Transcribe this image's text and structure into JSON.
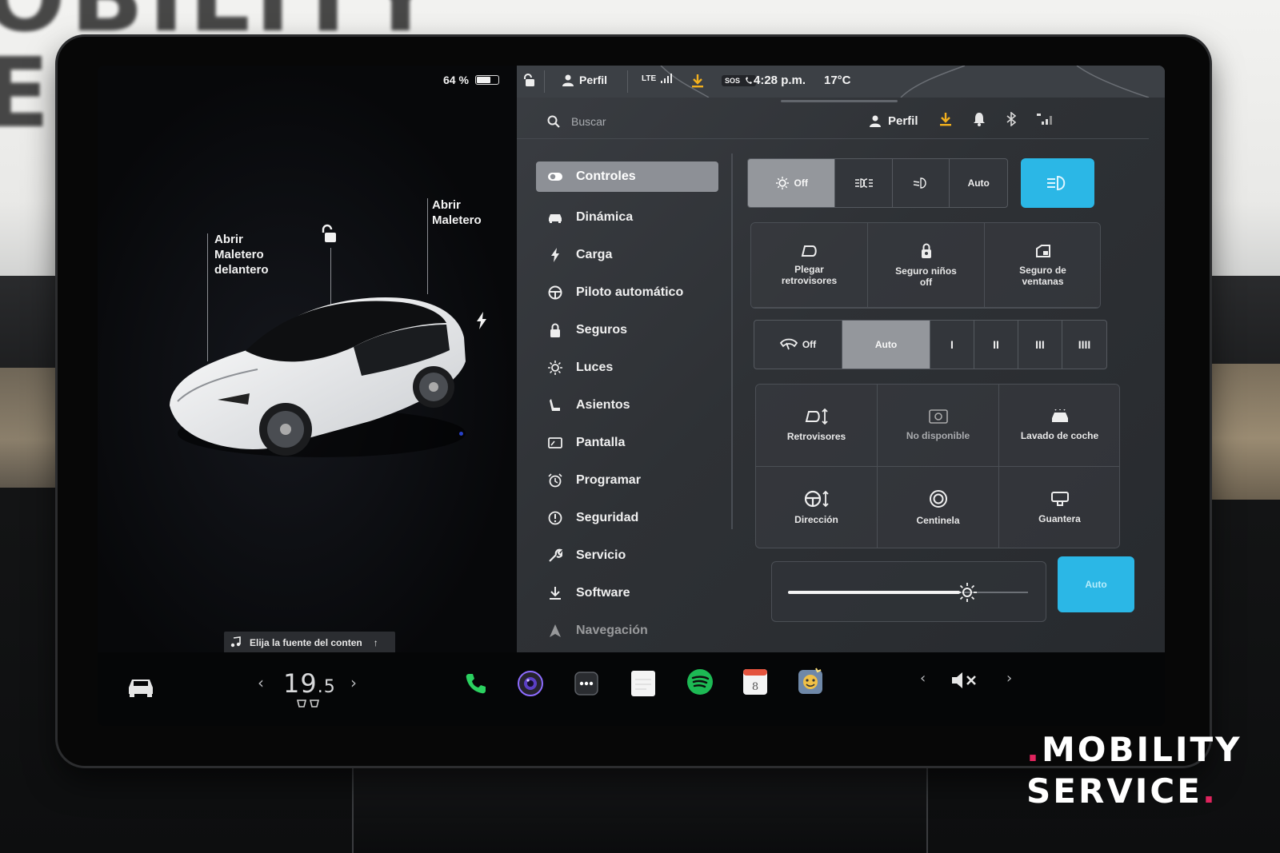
{
  "photo": {
    "wall_text": "OBILITY\nER",
    "watermark_line1": "MOBILITY",
    "watermark_line2": "SERVICE",
    "watermark_dot": ".",
    "watermark_dot_color": "#e0245e"
  },
  "car": {
    "battery_percent": "64 %",
    "battery_level": 0.64,
    "frunk_label": "Abrir\nMaletero\ndelantero",
    "trunk_label": "Abrir\nMaletero",
    "charge_icon": "bolt-icon",
    "lock_icon": "unlock-icon",
    "media_source": "Elija la fuente del conten"
  },
  "status_bar": {
    "profile": "Perfil",
    "network": "LTE",
    "sos": "SOS",
    "time": "4:28 p.m.",
    "outside_temp": "17°C"
  },
  "search": {
    "placeholder": "Buscar",
    "profile": "Perfil"
  },
  "menu": {
    "items": [
      {
        "label": "Controles",
        "icon": "toggle-icon",
        "active": true
      },
      {
        "label": "Dinámica",
        "icon": "car-icon"
      },
      {
        "label": "Carga",
        "icon": "bolt-icon"
      },
      {
        "label": "Piloto automático",
        "icon": "steering-wheel-icon"
      },
      {
        "label": "Seguros",
        "icon": "lock-icon"
      },
      {
        "label": "Luces",
        "icon": "sun-icon"
      },
      {
        "label": "Asientos",
        "icon": "seat-icon"
      },
      {
        "label": "Pantalla",
        "icon": "display-icon"
      },
      {
        "label": "Programar",
        "icon": "alarm-clock-icon"
      },
      {
        "label": "Seguridad",
        "icon": "warning-circle-icon"
      },
      {
        "label": "Servicio",
        "icon": "wrench-icon"
      },
      {
        "label": "Software",
        "icon": "download-icon"
      },
      {
        "label": "Navegación",
        "icon": "navigation-arrow-icon"
      }
    ]
  },
  "controls": {
    "lights": {
      "options": [
        "Off",
        "Parking",
        "Low beam",
        "Auto"
      ],
      "off_label": "Off",
      "auto_label": "Auto",
      "selected": "Off",
      "high_beam_accent": "#2bb7e6"
    },
    "tiles_top": {
      "fold_mirrors": "Plegar\nretrovisores",
      "child_lock": "Seguro niños\noff",
      "window_lock": "Seguro de\nventanas"
    },
    "wipers": {
      "off_label": "Off",
      "auto_label": "Auto",
      "speeds": [
        "I",
        "II",
        "III",
        "IIII"
      ],
      "selected": "Auto"
    },
    "tiles_bottom": {
      "mirrors": "Retrovisores",
      "unavailable": "No disponible",
      "car_wash": "Lavado de coche",
      "steering": "Dirección",
      "sentry": "Centinela",
      "glovebox": "Guantera"
    },
    "brightness": {
      "level": 0.77,
      "auto_label": "Auto"
    }
  },
  "dock": {
    "cabin_temp_whole": "19",
    "cabin_temp_decimal": ".5",
    "apps": [
      "phone-icon",
      "camera-icon",
      "more-apps-icon",
      "notes-icon",
      "spotify-icon",
      "calendar-icon",
      "toybox-icon"
    ],
    "calendar_day": "8",
    "volume_state": "muted"
  },
  "colors": {
    "accent_blue": "#2bb7e6",
    "menu_active": "#8d9096",
    "phone_green": "#2bd160",
    "spotify_green": "#1db954",
    "calendar_red": "#e4533d"
  }
}
